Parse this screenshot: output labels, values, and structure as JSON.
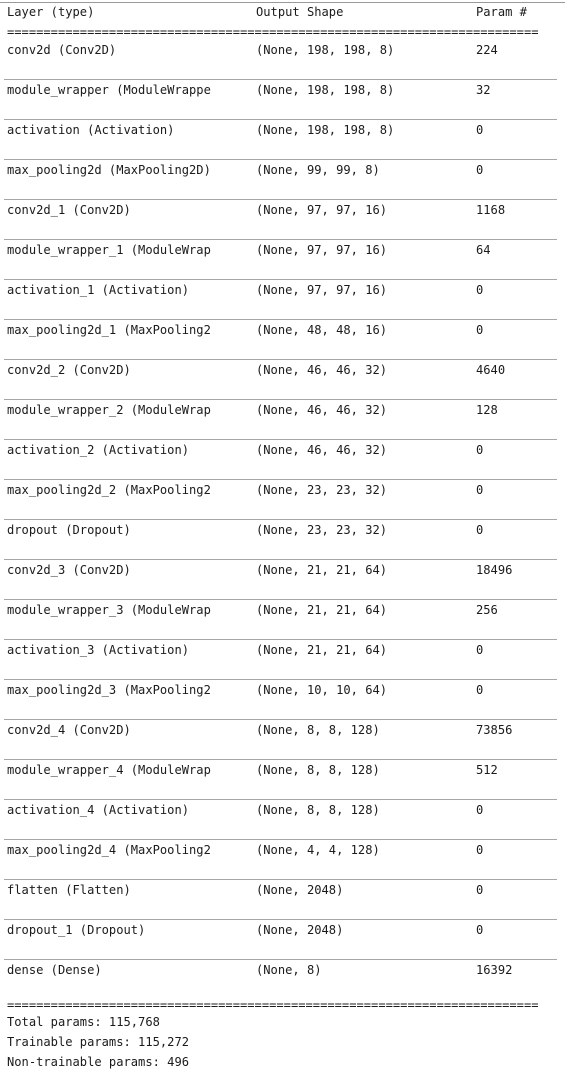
{
  "table": {
    "columns": {
      "layer": "Layer (type)",
      "shape": "Output Shape",
      "param": "Param #"
    },
    "separator_heavy": "=========================================================================",
    "rows": [
      {
        "layer": "conv2d (Conv2D)",
        "shape": "(None, 198, 198, 8)",
        "param": "224"
      },
      {
        "layer": "module_wrapper (ModuleWrappe",
        "shape": "(None, 198, 198, 8)",
        "param": "32"
      },
      {
        "layer": "activation (Activation)",
        "shape": "(None, 198, 198, 8)",
        "param": "0"
      },
      {
        "layer": "max_pooling2d (MaxPooling2D)",
        "shape": "(None, 99, 99, 8)",
        "param": "0"
      },
      {
        "layer": "conv2d_1 (Conv2D)",
        "shape": "(None, 97, 97, 16)",
        "param": "1168"
      },
      {
        "layer": "module_wrapper_1 (ModuleWrap",
        "shape": "(None, 97, 97, 16)",
        "param": "64"
      },
      {
        "layer": "activation_1 (Activation)",
        "shape": "(None, 97, 97, 16)",
        "param": "0"
      },
      {
        "layer": "max_pooling2d_1 (MaxPooling2",
        "shape": "(None, 48, 48, 16)",
        "param": "0"
      },
      {
        "layer": "conv2d_2 (Conv2D)",
        "shape": "(None, 46, 46, 32)",
        "param": "4640"
      },
      {
        "layer": "module_wrapper_2 (ModuleWrap",
        "shape": "(None, 46, 46, 32)",
        "param": "128"
      },
      {
        "layer": "activation_2 (Activation)",
        "shape": "(None, 46, 46, 32)",
        "param": "0"
      },
      {
        "layer": "max_pooling2d_2 (MaxPooling2",
        "shape": "(None, 23, 23, 32)",
        "param": "0"
      },
      {
        "layer": "dropout (Dropout)",
        "shape": "(None, 23, 23, 32)",
        "param": "0"
      },
      {
        "layer": "conv2d_3 (Conv2D)",
        "shape": "(None, 21, 21, 64)",
        "param": "18496"
      },
      {
        "layer": "module_wrapper_3 (ModuleWrap",
        "shape": "(None, 21, 21, 64)",
        "param": "256"
      },
      {
        "layer": "activation_3 (Activation)",
        "shape": "(None, 21, 21, 64)",
        "param": "0"
      },
      {
        "layer": "max_pooling2d_3 (MaxPooling2",
        "shape": "(None, 10, 10, 64)",
        "param": "0"
      },
      {
        "layer": "conv2d_4 (Conv2D)",
        "shape": "(None, 8, 8, 128)",
        "param": "73856"
      },
      {
        "layer": "module_wrapper_4 (ModuleWrap",
        "shape": "(None, 8, 8, 128)",
        "param": "512"
      },
      {
        "layer": "activation_4 (Activation)",
        "shape": "(None, 8, 8, 128)",
        "param": "0"
      },
      {
        "layer": "max_pooling2d_4 (MaxPooling2",
        "shape": "(None, 4, 4, 128)",
        "param": "0"
      },
      {
        "layer": "flatten (Flatten)",
        "shape": "(None, 2048)",
        "param": "0"
      },
      {
        "layer": "dropout_1 (Dropout)",
        "shape": "(None, 2048)",
        "param": "0"
      },
      {
        "layer": "dense (Dense)",
        "shape": "(None, 8)",
        "param": "16392"
      }
    ]
  },
  "footer": {
    "total_params": "Total params: 115,768",
    "trainable_params": "Trainable params: 115,272",
    "non_trainable_params": "Non-trainable params: 496"
  }
}
